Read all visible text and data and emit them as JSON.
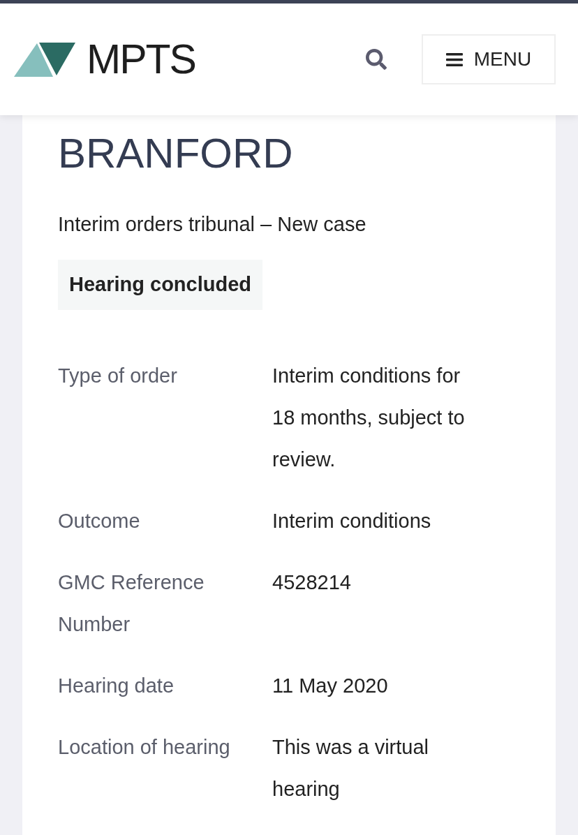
{
  "header": {
    "logo_text": "MPTS",
    "menu_button": {
      "label": "MENU"
    }
  },
  "case": {
    "name": "BRANFORD",
    "subtitle": "Interim orders tribunal – New case",
    "status": "Hearing concluded"
  },
  "details": [
    {
      "label": "Type of order",
      "value": "Interim conditions for 18 months, subject to review."
    },
    {
      "label": "Outcome",
      "value": "Interim conditions"
    },
    {
      "label": "GMC Reference Number",
      "value": "4528214"
    },
    {
      "label": "Hearing date",
      "value": "11 May 2020"
    },
    {
      "label": "Location of hearing",
      "value": "This was a virtual hearing"
    }
  ]
}
